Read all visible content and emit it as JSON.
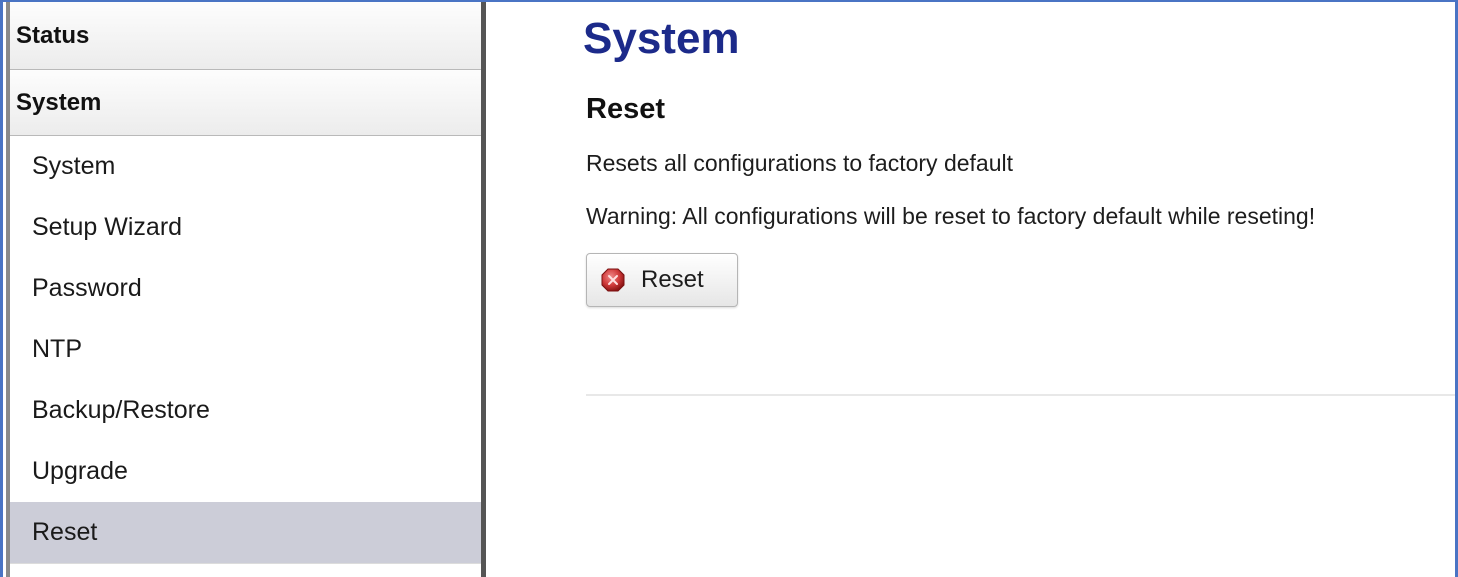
{
  "sidebar": {
    "sections": [
      {
        "label": "Status"
      },
      {
        "label": "System"
      }
    ],
    "items": [
      {
        "label": "System"
      },
      {
        "label": "Setup Wizard"
      },
      {
        "label": "Password"
      },
      {
        "label": "NTP"
      },
      {
        "label": "Backup/Restore"
      },
      {
        "label": "Upgrade"
      },
      {
        "label": "Reset",
        "active": true
      }
    ]
  },
  "main": {
    "title": "System",
    "section_title": "Reset",
    "description": "Resets all configurations to factory default",
    "warning": "Warning: All configurations will be reset to factory default while reseting!",
    "reset_button": {
      "label": "Reset",
      "icon": "reset-stop-icon"
    }
  },
  "colors": {
    "title": "#1c2a8a",
    "active_item_bg": "#cccdd8",
    "frame_border": "#4a74c4",
    "icon_red": "#d03a3a"
  }
}
